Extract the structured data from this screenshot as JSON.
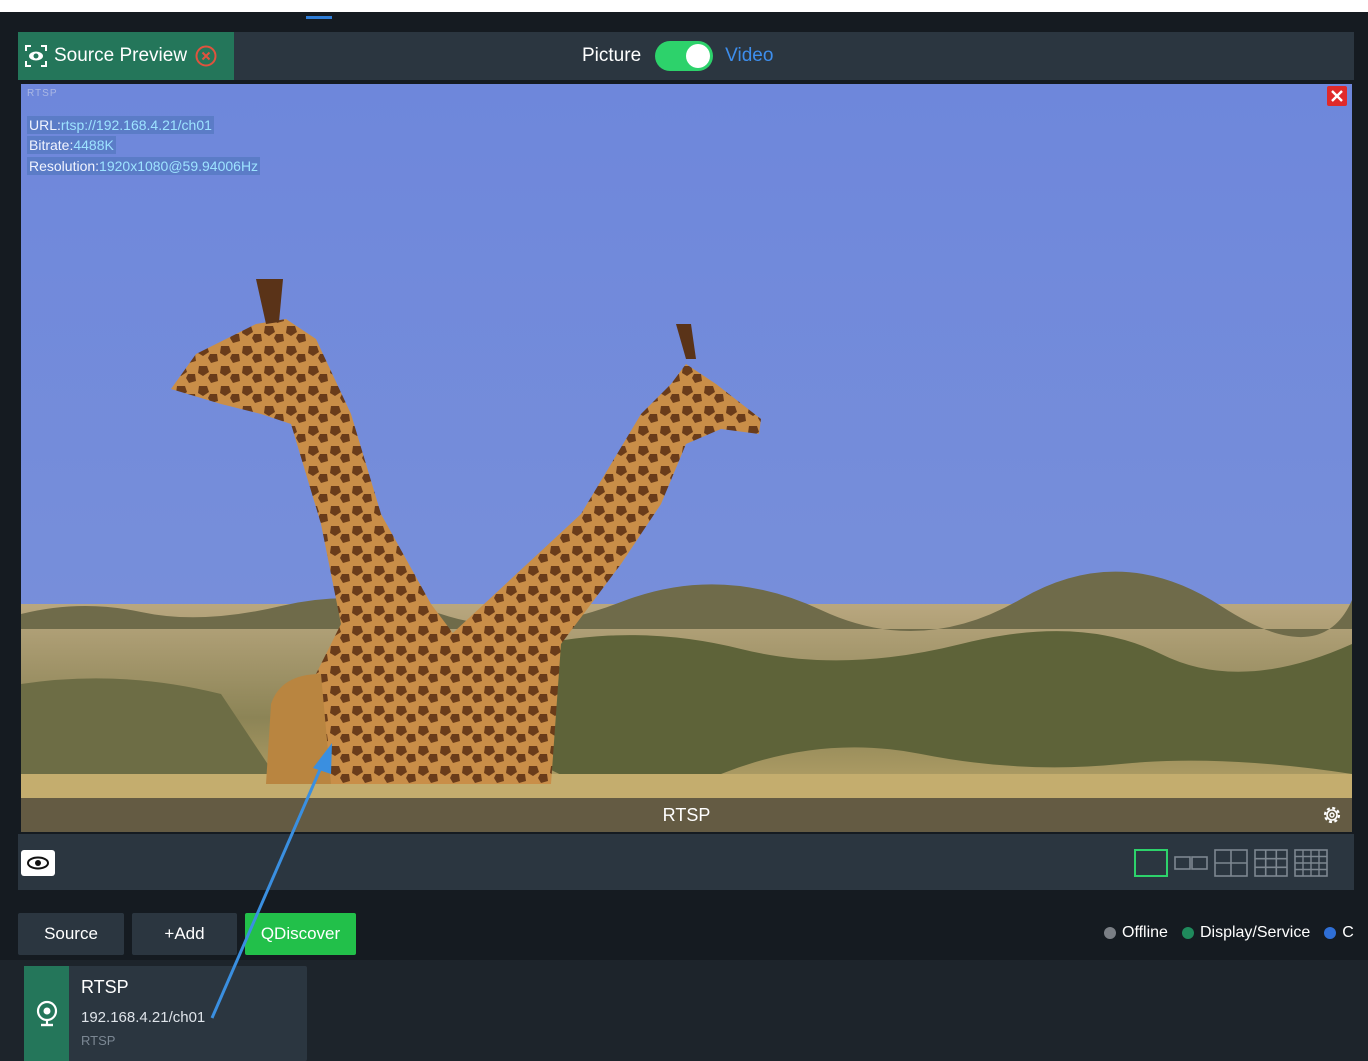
{
  "header": {
    "title": "Source Preview",
    "toggle_left": "Picture",
    "toggle_right": "Video",
    "toggle_on": true
  },
  "preview": {
    "protocol_mark": "RTSP",
    "url_label": "URL:",
    "url_value": "rtsp://192.168.4.21/ch01",
    "bitrate_label": "Bitrate:",
    "bitrate_value": "4488K",
    "resolution_label": "Resolution:",
    "resolution_value": "1920x1080@59.94006Hz",
    "bottom_label": "RTSP"
  },
  "toolbar": {
    "layouts": [
      "1x1",
      "1x2",
      "2x2",
      "3x3",
      "4x4"
    ],
    "selected_layout": "1x1"
  },
  "source_bar": {
    "source_label": "Source",
    "add_label": "+Add",
    "discover_label": "QDiscover",
    "legend": [
      {
        "label": "Offline",
        "color": "#7a7f85"
      },
      {
        "label": "Display/Service",
        "color": "#1f8a5c"
      },
      {
        "label": "C",
        "color": "#2f6fd6"
      }
    ]
  },
  "sources": [
    {
      "name": "RTSP",
      "address": "192.168.4.21/ch01",
      "protocol": "RTSP"
    }
  ],
  "colors": {
    "accent_green": "#24765a",
    "discover_green": "#22c04a",
    "toggle_green": "#2dd26b",
    "link_blue": "#3d8eed",
    "panel": "#2b3640",
    "background": "#151b21"
  }
}
